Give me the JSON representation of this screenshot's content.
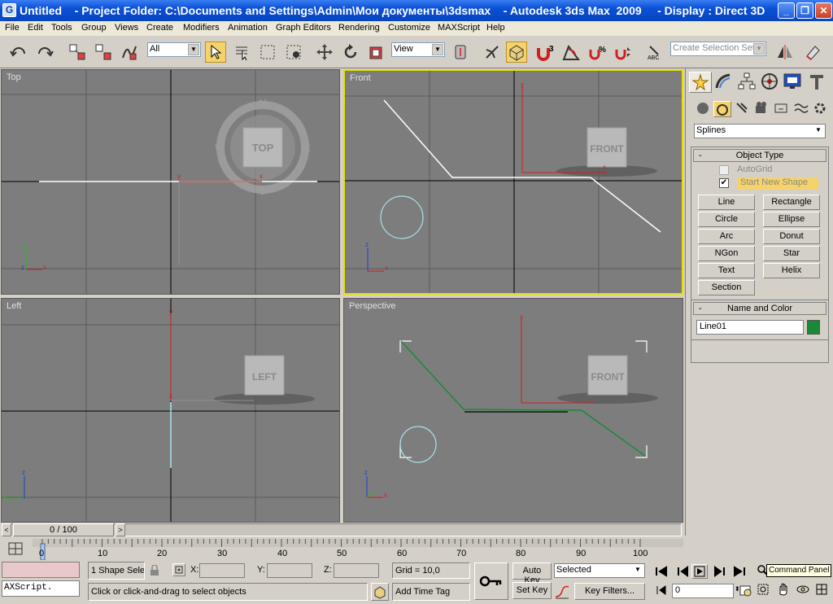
{
  "window": {
    "title": "Untitled    - Project Folder: C:\\Documents and Settings\\Admin\\Мои документы\\3dsmax    - Autodesk 3ds Max  2009     - Display : Direct 3D"
  },
  "menu": [
    "File",
    "Edit",
    "Tools",
    "Group",
    "Views",
    "Create",
    "Modifiers",
    "Animation",
    "Graph Editors",
    "Rendering",
    "Customize",
    "MAXScript",
    "Help"
  ],
  "toolbar": {
    "selection_filter": "All",
    "reference_coord": "View",
    "named_selection_placeholder": "Create Selection Set"
  },
  "viewports": {
    "top": {
      "label": "Top",
      "cube_label": "TOP",
      "compass": [
        "N",
        "E",
        "S",
        "W"
      ]
    },
    "front": {
      "label": "Front",
      "cube_label": "FRONT"
    },
    "left": {
      "label": "Left",
      "cube_label": "LEFT"
    },
    "perspective": {
      "label": "Perspective",
      "cube_label": "FRONT"
    }
  },
  "command_panel": {
    "category": "Splines",
    "object_type_title": "Object Type",
    "autogrid_label": "AutoGrid",
    "start_new_shape_label": "Start New Shape",
    "buttons": [
      "Line",
      "Rectangle",
      "Circle",
      "Ellipse",
      "Arc",
      "Donut",
      "NGon",
      "Star",
      "Text",
      "Helix",
      "Section"
    ],
    "name_color_title": "Name and Color",
    "object_name": "Line01",
    "object_color": "#1a8a3a",
    "tooltip": "Command Panel"
  },
  "timeline": {
    "frame_counter": "0 / 100",
    "ticks": [
      "0",
      "10",
      "20",
      "30",
      "40",
      "50",
      "60",
      "70",
      "80",
      "90",
      "100"
    ]
  },
  "status": {
    "maxscript_label": "AXScript.",
    "selection_text": "1 Shape Sele",
    "x_label": "X:",
    "y_label": "Y:",
    "z_label": "Z:",
    "grid": "Grid = 10,0",
    "prompt": "Click or click-and-drag to select objects",
    "add_time_tag": "Add Time Tag",
    "auto_key": "Auto Key",
    "set_key": "Set Key",
    "key_mode": "Selected",
    "key_filters": "Key Filters...",
    "current_frame": "0"
  },
  "colors": {
    "viewport_bg": "#7d7d7d",
    "active_border": "#e8e000",
    "titlebar": "#0a4fd6",
    "spline_white": "#ffffff",
    "spline_cyan": "#a8e0e8",
    "spline_green": "#1a8a3a",
    "axis_red": "#d02020",
    "axis_green": "#20c020",
    "axis_blue": "#2040d0"
  }
}
